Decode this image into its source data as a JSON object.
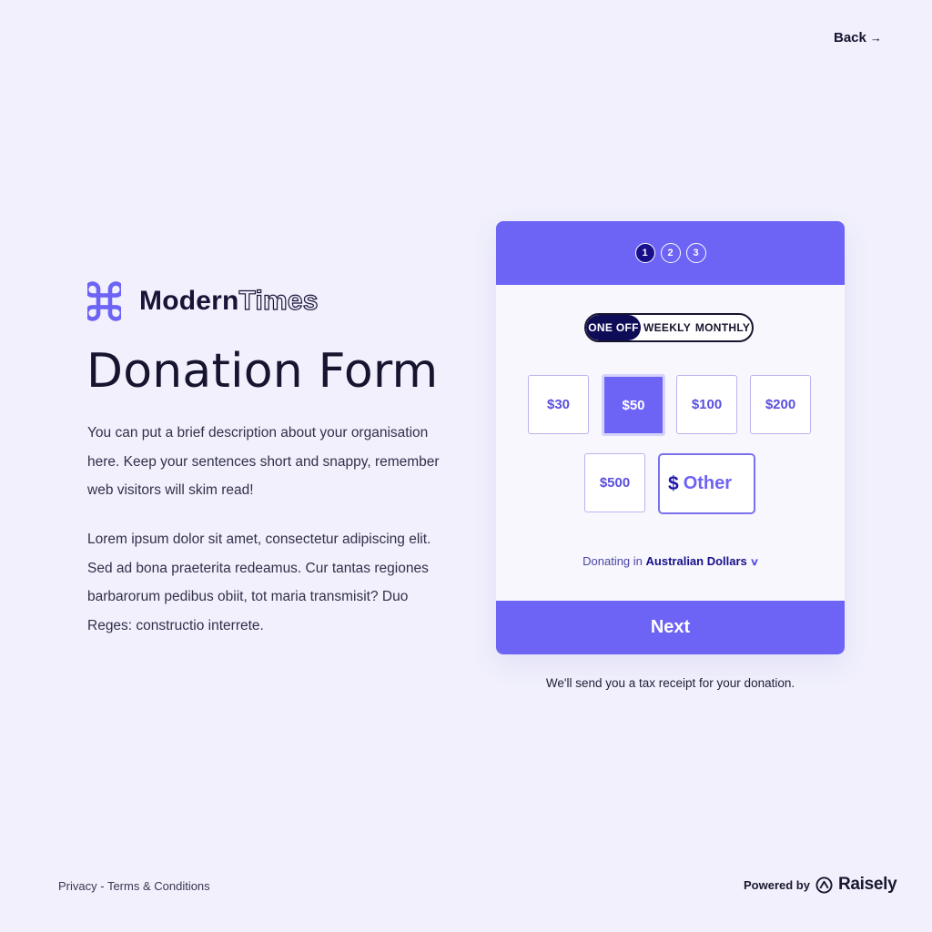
{
  "nav": {
    "back_label": "Back",
    "back_arrow": "→"
  },
  "brand": {
    "name_bold": "Modern",
    "name_outline": "Times",
    "logo_icon": "command-key-icon",
    "logo_color": "#6d63f5"
  },
  "page": {
    "title": "Donation Form",
    "description_1": "You can put a brief description about your organisation here. Keep your sentences short and snappy, remember web visitors will skim read!",
    "description_2": "Lorem ipsum dolor sit amet, consectetur adipiscing elit. Sed ad bona praeterita redeamus. Cur tantas regiones barbarorum pedibus obiit, tot maria transmisit? Duo Reges: constructio interrete."
  },
  "form": {
    "steps": [
      {
        "label": "1",
        "active": true
      },
      {
        "label": "2",
        "active": false
      },
      {
        "label": "3",
        "active": false
      }
    ],
    "frequency": {
      "options": [
        "ONE OFF",
        "WEEKLY",
        "MONTHLY"
      ],
      "selected": "ONE OFF"
    },
    "amounts": [
      "$30",
      "$50",
      "$100",
      "$200",
      "$500"
    ],
    "selected_amount": "$50",
    "other": {
      "currency_symbol": "$",
      "placeholder": "Other"
    },
    "currency_prefix": "Donating in",
    "currency": "Australian Dollars",
    "next_label": "Next"
  },
  "receipt_note": "We'll send you a tax receipt for your donation.",
  "footer": {
    "privacy": "Privacy",
    "separator": " - ",
    "terms": "Terms & Conditions",
    "powered_label": "Powered by",
    "powered_brand": "Raisely"
  },
  "colors": {
    "accent": "#6d63f5",
    "dark_navy": "#0f0c57",
    "background": "#f1f0fc"
  }
}
